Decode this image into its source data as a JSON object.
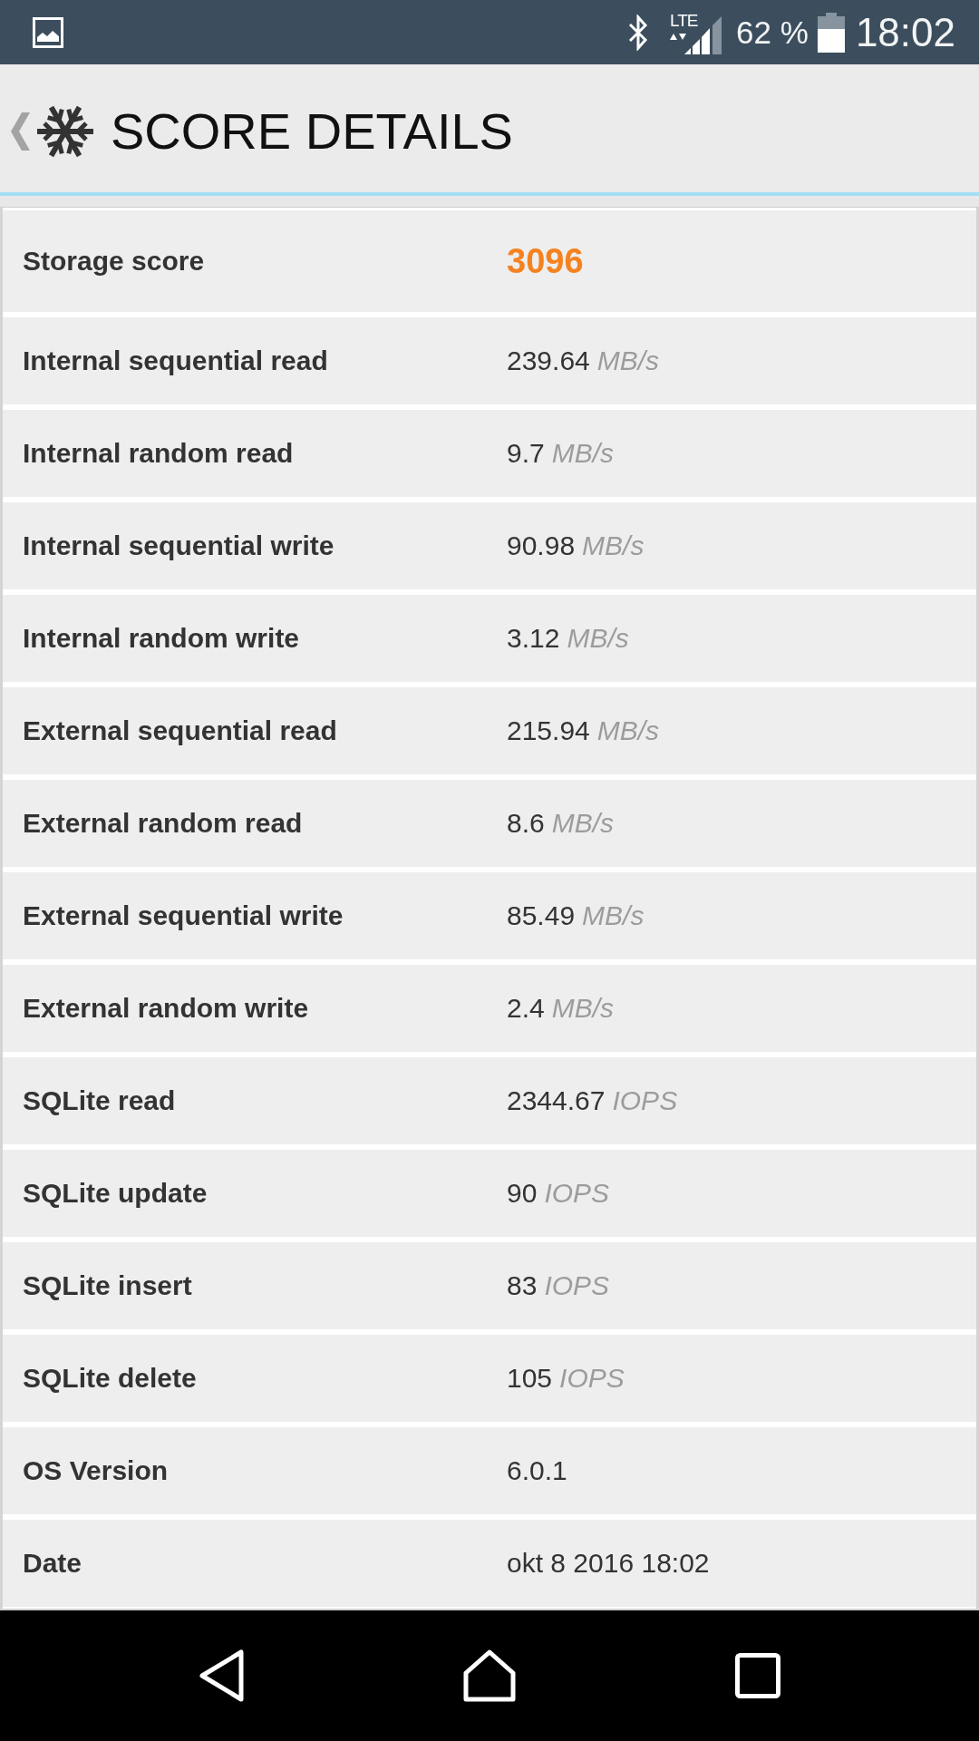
{
  "status_bar": {
    "network": "LTE",
    "battery": "62 %",
    "time": "18:02"
  },
  "header": {
    "title": "SCORE DETAILS"
  },
  "rows": [
    {
      "kind": "score",
      "label": "Storage score",
      "value": "3096"
    },
    {
      "kind": "metric",
      "label": "Internal sequential read",
      "value": "239.64",
      "unit": "MB/s"
    },
    {
      "kind": "metric",
      "label": "Internal random read",
      "value": "9.7",
      "unit": "MB/s"
    },
    {
      "kind": "metric",
      "label": "Internal sequential write",
      "value": "90.98",
      "unit": "MB/s"
    },
    {
      "kind": "metric",
      "label": "Internal random write",
      "value": "3.12",
      "unit": "MB/s"
    },
    {
      "kind": "metric",
      "label": "External sequential read",
      "value": "215.94",
      "unit": "MB/s"
    },
    {
      "kind": "metric",
      "label": "External random read",
      "value": "8.6",
      "unit": "MB/s"
    },
    {
      "kind": "metric",
      "label": "External sequential write",
      "value": "85.49",
      "unit": "MB/s"
    },
    {
      "kind": "metric",
      "label": "External random write",
      "value": "2.4",
      "unit": "MB/s"
    },
    {
      "kind": "metric",
      "label": "SQLite read",
      "value": "2344.67",
      "unit": "IOPS"
    },
    {
      "kind": "metric",
      "label": "SQLite update",
      "value": "90",
      "unit": "IOPS"
    },
    {
      "kind": "metric",
      "label": "SQLite insert",
      "value": "83",
      "unit": "IOPS"
    },
    {
      "kind": "metric",
      "label": "SQLite delete",
      "value": "105",
      "unit": "IOPS"
    },
    {
      "kind": "metric",
      "label": "OS Version",
      "value": "6.0.1"
    },
    {
      "kind": "metric",
      "label": "Date",
      "value": "okt 8 2016 18:02"
    }
  ]
}
